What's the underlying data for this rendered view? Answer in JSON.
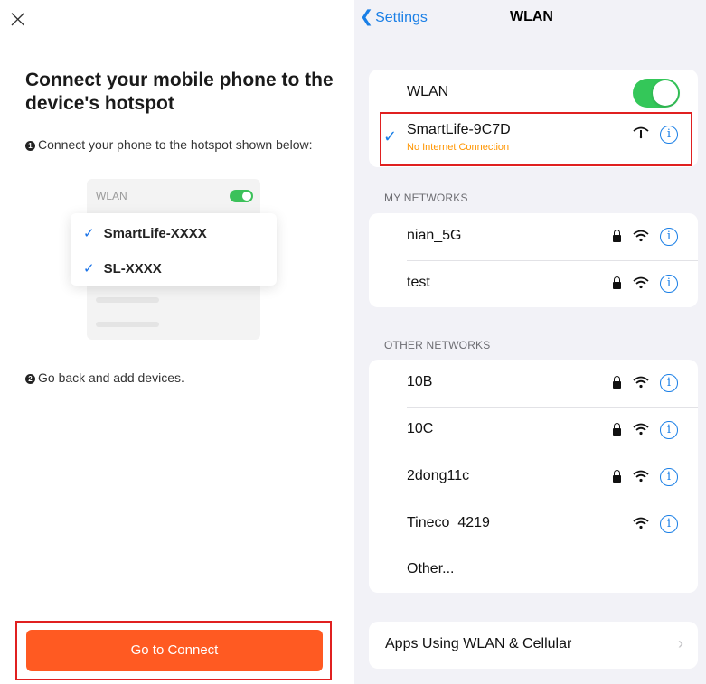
{
  "left": {
    "close_glyph": "×",
    "title": "Connect your mobile phone to the device's hotspot",
    "step1_num": "1",
    "step1": "Connect your phone to the hotspot shown below:",
    "illustration": {
      "wlan_label": "WLAN",
      "network1": "SmartLife-XXXX",
      "network2": "SL-XXXX",
      "check_glyph": "✓"
    },
    "step2_num": "2",
    "step2": "Go back and add devices.",
    "connect_button": "Go to Connect"
  },
  "right": {
    "nav": {
      "back_label": "Settings",
      "back_glyph": "❮",
      "title": "WLAN"
    },
    "wlan_label": "WLAN",
    "connected_network": {
      "name": "SmartLife-9C7D",
      "status": "No Internet Connection"
    },
    "my_networks_label": "MY NETWORKS",
    "my_networks": [
      {
        "name": "nian_5G"
      },
      {
        "name": "test"
      }
    ],
    "other_networks_label": "OTHER NETWORKS",
    "other_networks": [
      {
        "name": "10B"
      },
      {
        "name": "10C"
      },
      {
        "name": "2dong11c"
      },
      {
        "name": "Tineco_4219"
      }
    ],
    "other_label": "Other...",
    "apps_label": "Apps Using WLAN & Cellular",
    "info_glyph": "i",
    "check_glyph": "✓",
    "chevron_glyph": "›"
  },
  "colors": {
    "accent_blue": "#1a7fe6",
    "toggle_green": "#34c759",
    "warning_orange": "#ff9500",
    "button_orange": "#ff5a22",
    "highlight_red": "#e02020"
  }
}
